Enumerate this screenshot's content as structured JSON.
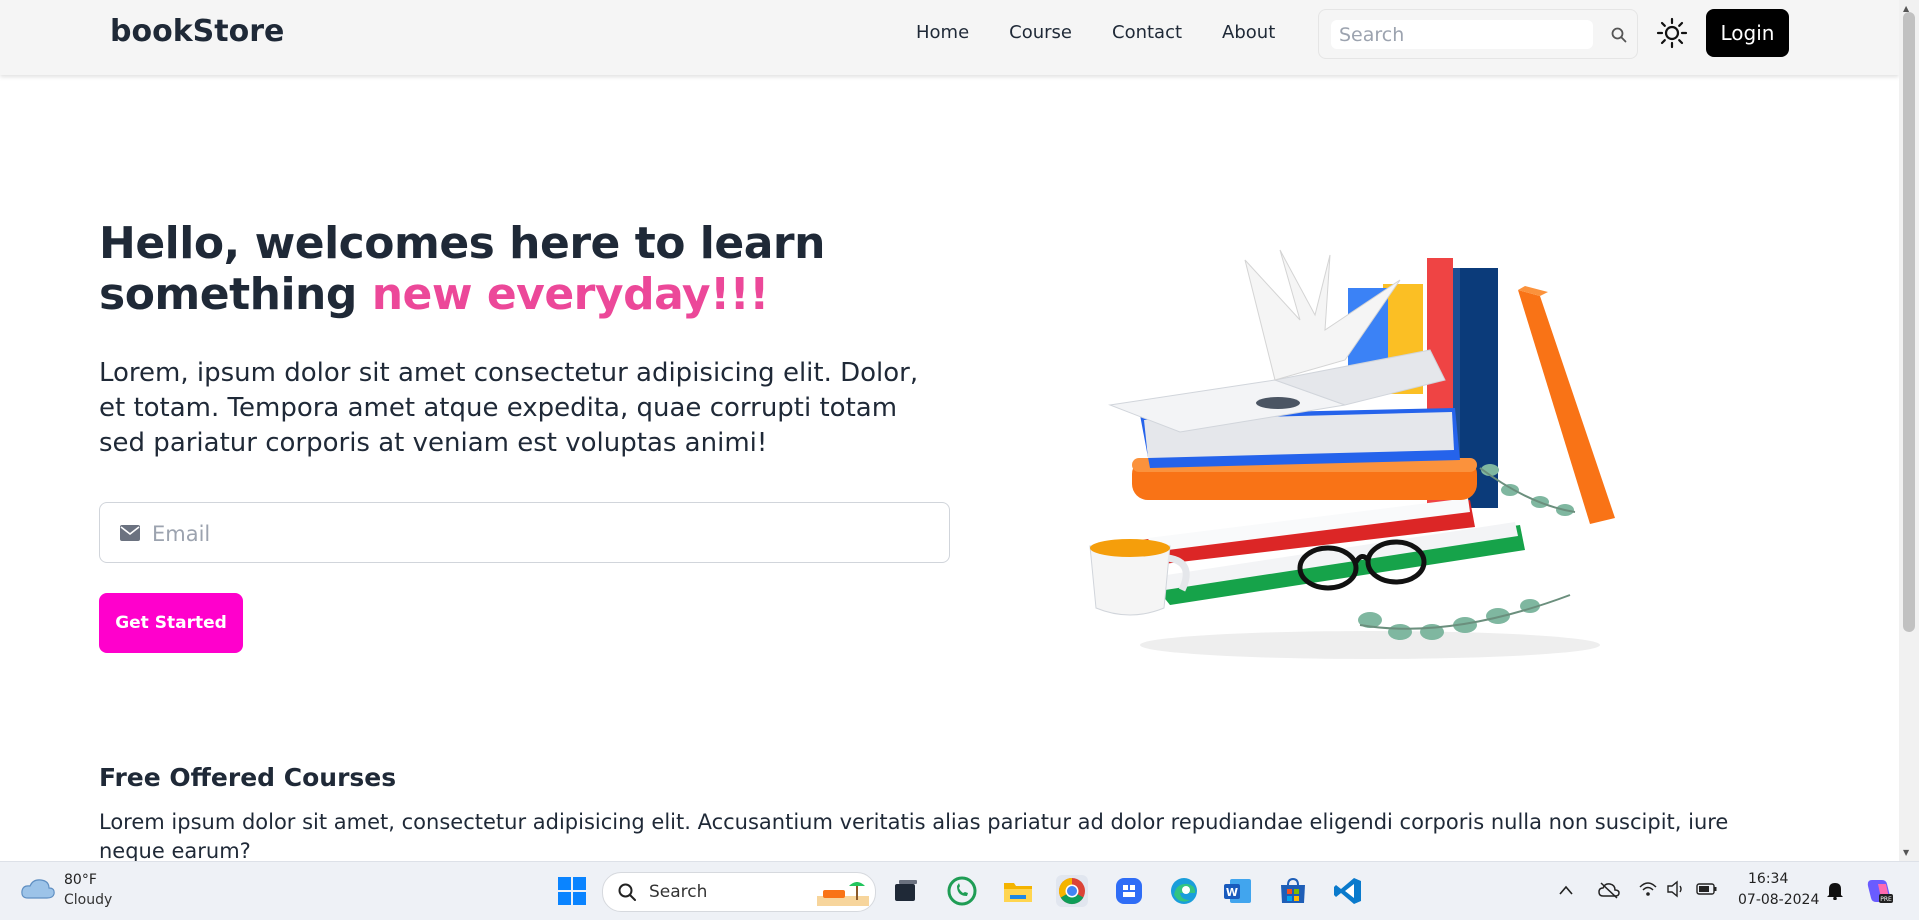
{
  "navbar": {
    "brand": "bookStore",
    "links": [
      "Home",
      "Course",
      "Contact",
      "About"
    ],
    "search_placeholder": "Search",
    "login_label": "Login"
  },
  "hero": {
    "title_line1": "Hello, welcomes here to learn",
    "title_line2_plain": "something ",
    "title_line2_accent": "new everyday!!!",
    "description": "Lorem, ipsum dolor sit amet consectetur adipisicing elit. Dolor, et totam. Tempora amet atque expedita, quae corrupti totam sed pariatur corporis at veniam est voluptas animi!",
    "email_placeholder": "Email",
    "cta_label": "Get Started"
  },
  "courses": {
    "title": "Free Offered Courses",
    "description": "Lorem ipsum dolor sit amet, consectetur adipisicing elit. Accusantium veritatis alias pariatur ad dolor repudiandae eligendi corporis nulla non suscipit, iure neque earum?"
  },
  "taskbar": {
    "weather_temp": "80°F",
    "weather_condition": "Cloudy",
    "search_label": "Search",
    "time": "16:34",
    "date": "07-08-2024",
    "apps": [
      "windows-start",
      "search",
      "task-view",
      "whatsapp",
      "file-explorer",
      "chrome",
      "app-tile",
      "edge",
      "word",
      "microsoft-store",
      "vscode"
    ]
  },
  "colors": {
    "accent_pink": "#ec4899",
    "cta_magenta": "#ff00cc",
    "login_black": "#000000",
    "navbar_bg": "#f5f5f5"
  }
}
